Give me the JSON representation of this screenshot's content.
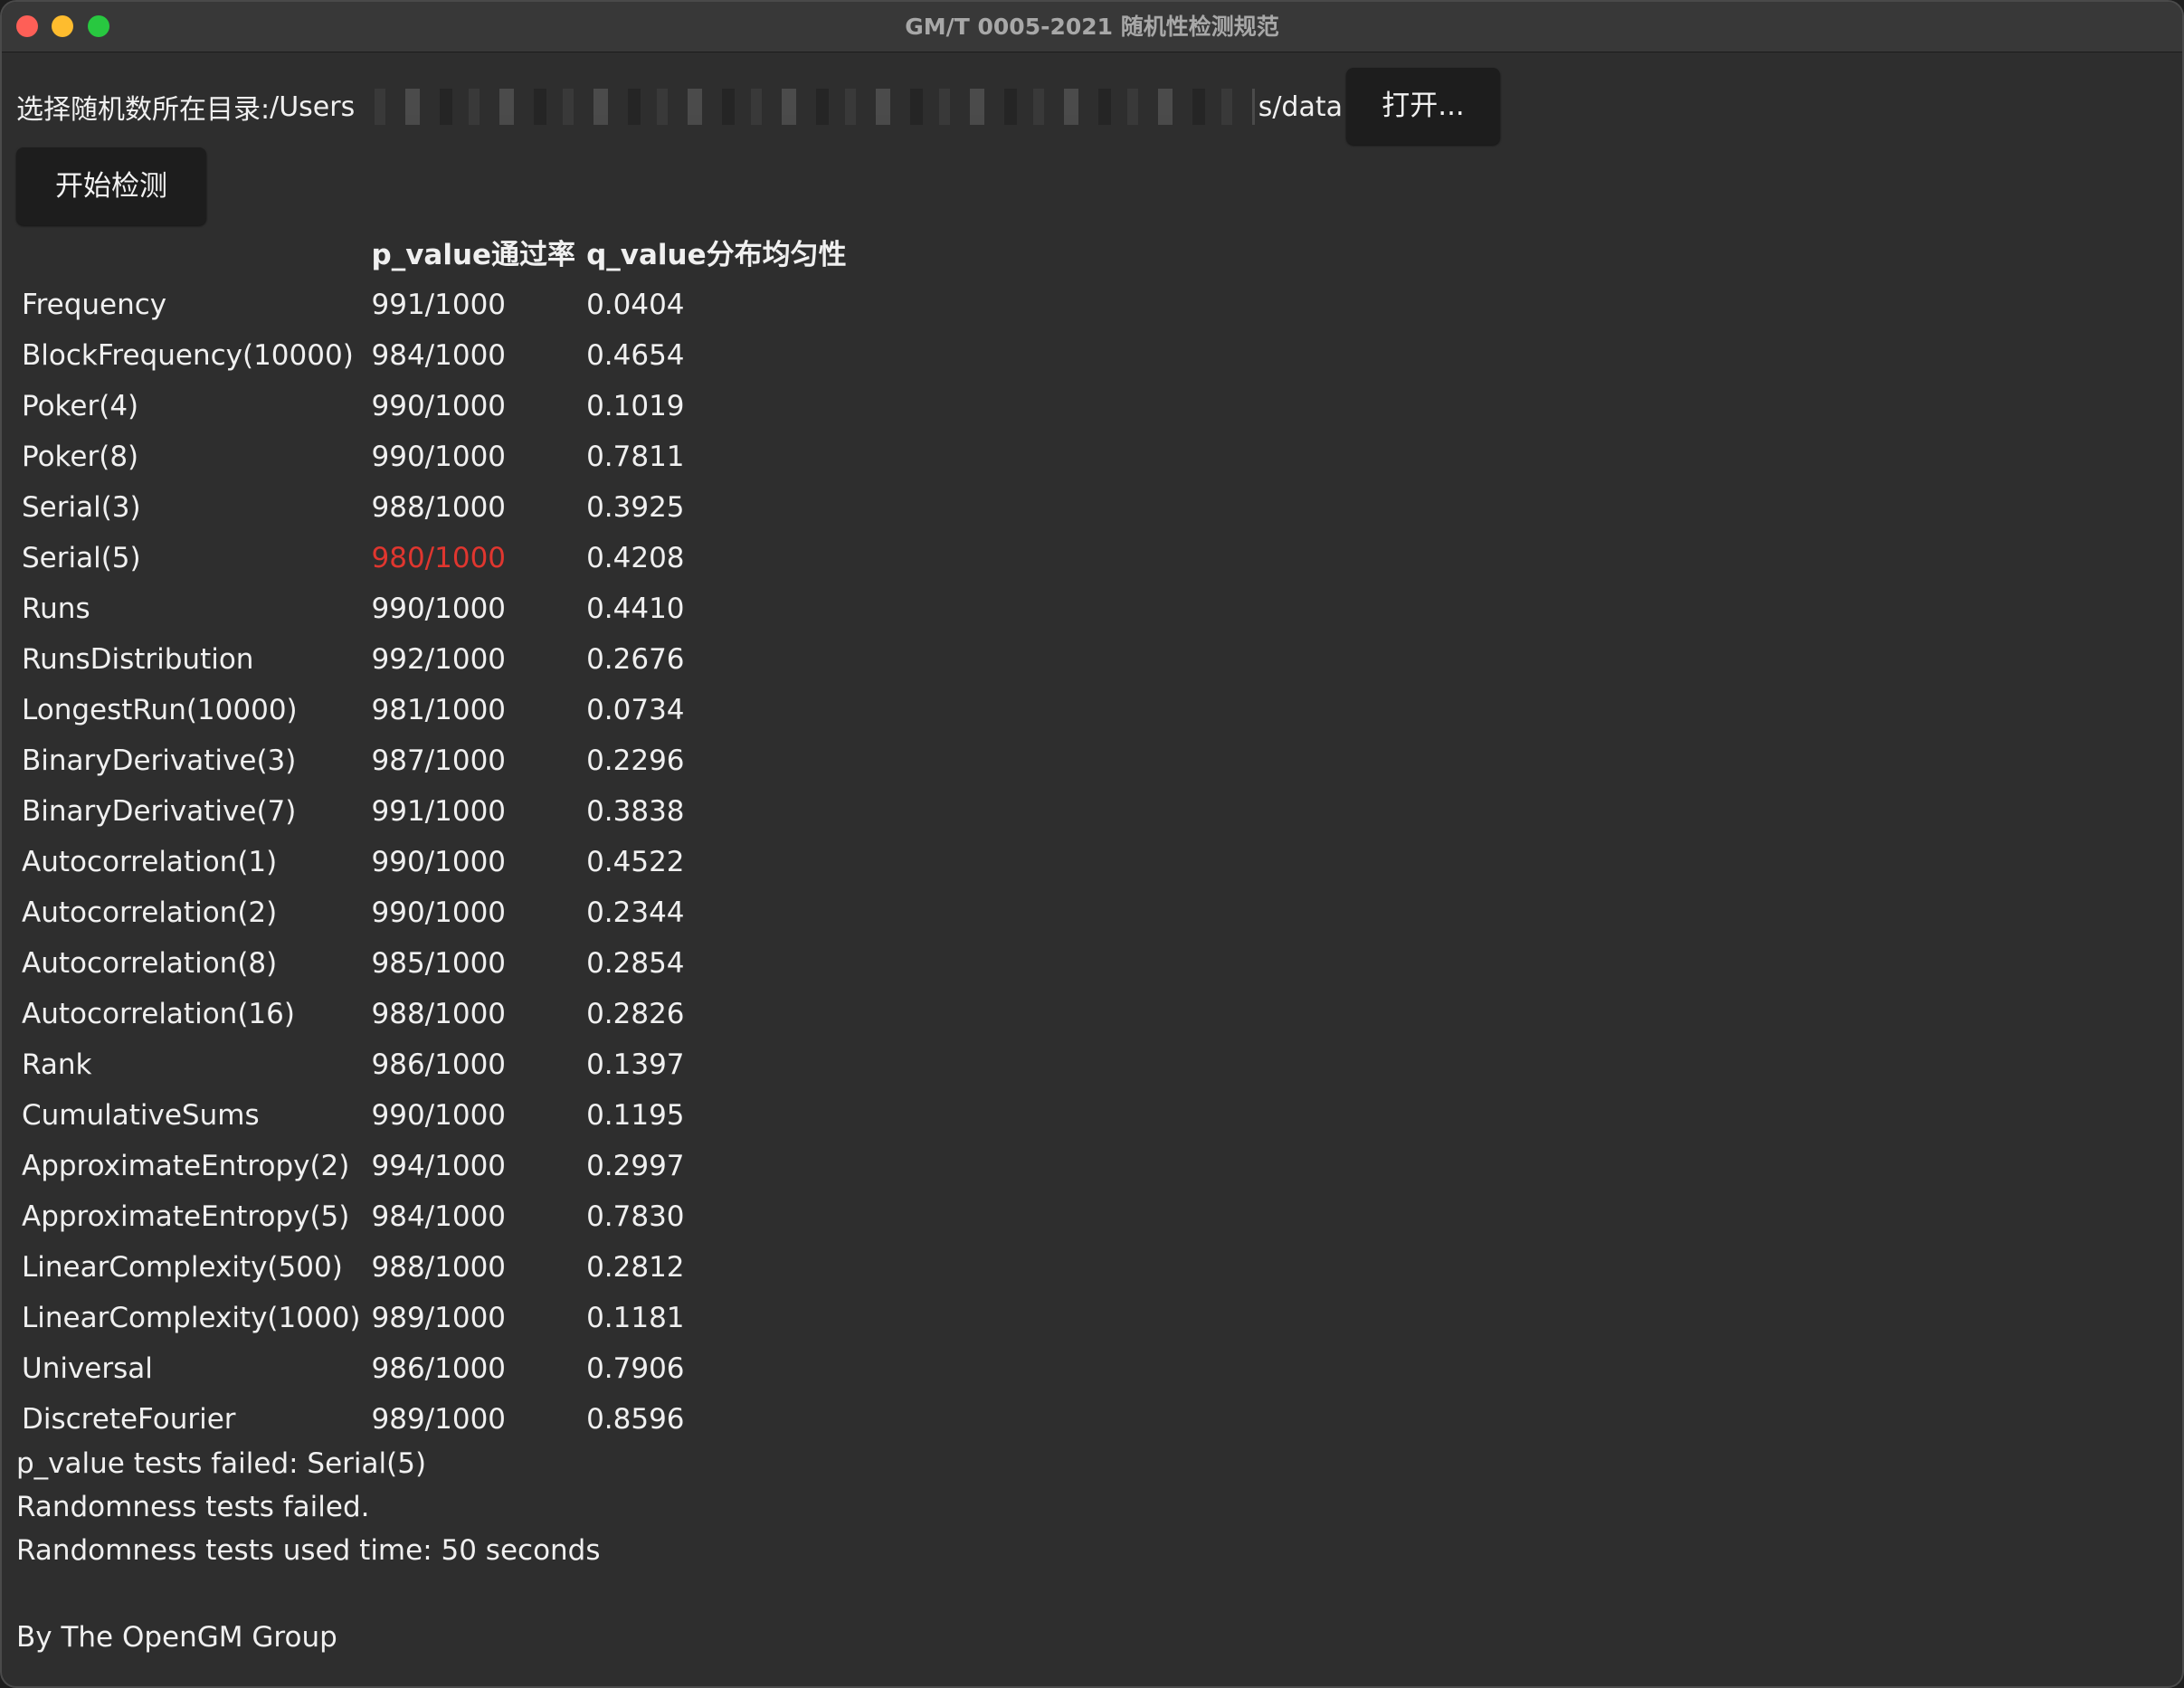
{
  "window": {
    "title": "GM/T 0005-2021 随机性检测规范"
  },
  "directory": {
    "label": "选择随机数所在目录:",
    "path_prefix": "/Users",
    "path_suffix": "s/data",
    "open_button": "打开..."
  },
  "start_button": "开始检测",
  "table": {
    "headers": {
      "name": "",
      "p_value": "p_value通过率",
      "q_value": "q_value分布均匀性"
    },
    "rows": [
      {
        "name": "Frequency",
        "p": "991/1000",
        "q": "0.0404",
        "failed": false
      },
      {
        "name": "BlockFrequency(10000)",
        "p": "984/1000",
        "q": "0.4654",
        "failed": false
      },
      {
        "name": "Poker(4)",
        "p": "990/1000",
        "q": "0.1019",
        "failed": false
      },
      {
        "name": "Poker(8)",
        "p": "990/1000",
        "q": "0.7811",
        "failed": false
      },
      {
        "name": "Serial(3)",
        "p": "988/1000",
        "q": "0.3925",
        "failed": false
      },
      {
        "name": "Serial(5)",
        "p": "980/1000",
        "q": "0.4208",
        "failed": true
      },
      {
        "name": "Runs",
        "p": "990/1000",
        "q": "0.4410",
        "failed": false
      },
      {
        "name": "RunsDistribution",
        "p": "992/1000",
        "q": "0.2676",
        "failed": false
      },
      {
        "name": "LongestRun(10000)",
        "p": "981/1000",
        "q": "0.0734",
        "failed": false
      },
      {
        "name": "BinaryDerivative(3)",
        "p": "987/1000",
        "q": "0.2296",
        "failed": false
      },
      {
        "name": "BinaryDerivative(7)",
        "p": "991/1000",
        "q": "0.3838",
        "failed": false
      },
      {
        "name": "Autocorrelation(1)",
        "p": "990/1000",
        "q": "0.4522",
        "failed": false
      },
      {
        "name": "Autocorrelation(2)",
        "p": "990/1000",
        "q": "0.2344",
        "failed": false
      },
      {
        "name": "Autocorrelation(8)",
        "p": "985/1000",
        "q": "0.2854",
        "failed": false
      },
      {
        "name": "Autocorrelation(16)",
        "p": "988/1000",
        "q": "0.2826",
        "failed": false
      },
      {
        "name": "Rank",
        "p": "986/1000",
        "q": "0.1397",
        "failed": false
      },
      {
        "name": "CumulativeSums",
        "p": "990/1000",
        "q": "0.1195",
        "failed": false
      },
      {
        "name": "ApproximateEntropy(2)",
        "p": "994/1000",
        "q": "0.2997",
        "failed": false
      },
      {
        "name": "ApproximateEntropy(5)",
        "p": "984/1000",
        "q": "0.7830",
        "failed": false
      },
      {
        "name": "LinearComplexity(500)",
        "p": "988/1000",
        "q": "0.2812",
        "failed": false
      },
      {
        "name": "LinearComplexity(1000)",
        "p": "989/1000",
        "q": "0.1181",
        "failed": false
      },
      {
        "name": "Universal",
        "p": "986/1000",
        "q": "0.7906",
        "failed": false
      },
      {
        "name": "DiscreteFourier",
        "p": "989/1000",
        "q": "0.8596",
        "failed": false
      }
    ]
  },
  "summary": {
    "failed_tests": "p_value tests failed: Serial(5)",
    "result": "Randomness tests failed.",
    "time": "Randomness tests used time: 50 seconds",
    "credit": "By The OpenGM Group"
  },
  "colors": {
    "fail": "#e0362f",
    "text": "#f0f0f0",
    "background": "#2e2e2e"
  }
}
